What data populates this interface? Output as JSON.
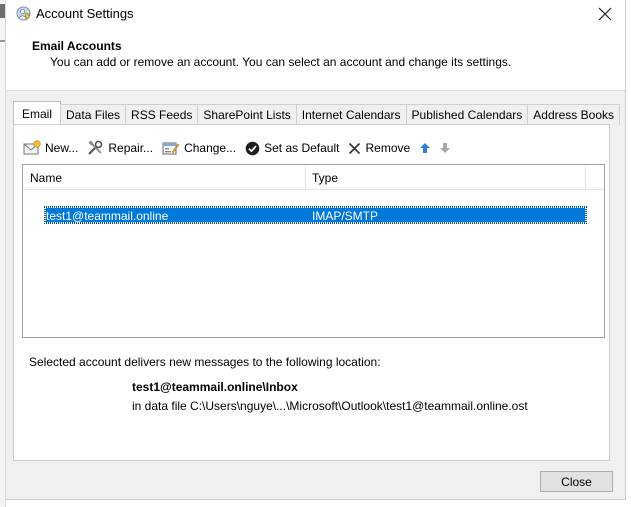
{
  "window": {
    "title": "Account Settings"
  },
  "header": {
    "title": "Email Accounts",
    "description": "You can add or remove an account. You can select an account and change its settings."
  },
  "tabs": [
    {
      "label": "Email",
      "active": true
    },
    {
      "label": "Data Files"
    },
    {
      "label": "RSS Feeds"
    },
    {
      "label": "SharePoint Lists"
    },
    {
      "label": "Internet Calendars"
    },
    {
      "label": "Published Calendars"
    },
    {
      "label": "Address Books"
    }
  ],
  "toolbar": {
    "new_label": "New...",
    "repair_label": "Repair...",
    "change_label": "Change...",
    "set_default_label": "Set as Default",
    "remove_label": "Remove"
  },
  "accounts_list": {
    "columns": {
      "name": "Name",
      "type": "Type"
    },
    "rows": [
      {
        "name": "test1@teammail.online",
        "type": "IMAP/SMTP",
        "selected": true
      }
    ]
  },
  "delivery": {
    "text": "Selected account delivers new messages to the following location:",
    "inbox_path": "test1@teammail.online\\Inbox",
    "data_file": "in data file C:\\Users\\nguye\\...\\Microsoft\\Outlook\\test1@teammail.online.ost"
  },
  "footer": {
    "close_label": "Close"
  },
  "colors": {
    "selection": "#0078d7",
    "window_bg": "#f0f0f0"
  }
}
